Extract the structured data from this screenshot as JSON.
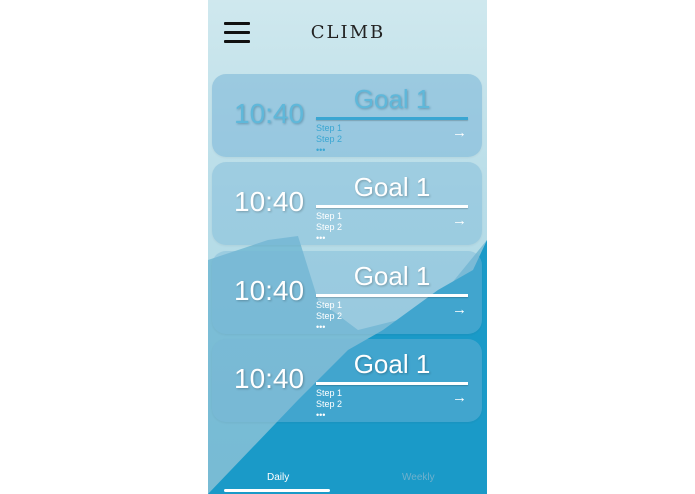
{
  "app": {
    "logo_text": "CLIMB"
  },
  "header": {
    "menu_icon": "hamburger-menu-icon"
  },
  "goals": [
    {
      "time": "10:40",
      "title": "Goal 1",
      "step1": "Step 1",
      "step2": "Step 2",
      "more": "•••",
      "arrow": "→",
      "highlighted": true
    },
    {
      "time": "10:40",
      "title": "Goal 1",
      "step1": "Step 1",
      "step2": "Step 2",
      "more": "•••",
      "arrow": "→"
    },
    {
      "time": "10:40",
      "title": "Goal 1",
      "step1": "Step 1",
      "step2": "Step 2",
      "more": "•••",
      "arrow": "→"
    },
    {
      "time": "10:40",
      "title": "Goal 1",
      "step1": "Step 1",
      "step2": "Step 2",
      "more": "•••",
      "arrow": "→"
    }
  ],
  "tabs": {
    "daily": "Daily",
    "weekly": "Weekly",
    "active": "Daily"
  },
  "colors": {
    "accent": "#3aa6d2",
    "mountain": "#1a9ac8",
    "background": "#b8dde8"
  }
}
